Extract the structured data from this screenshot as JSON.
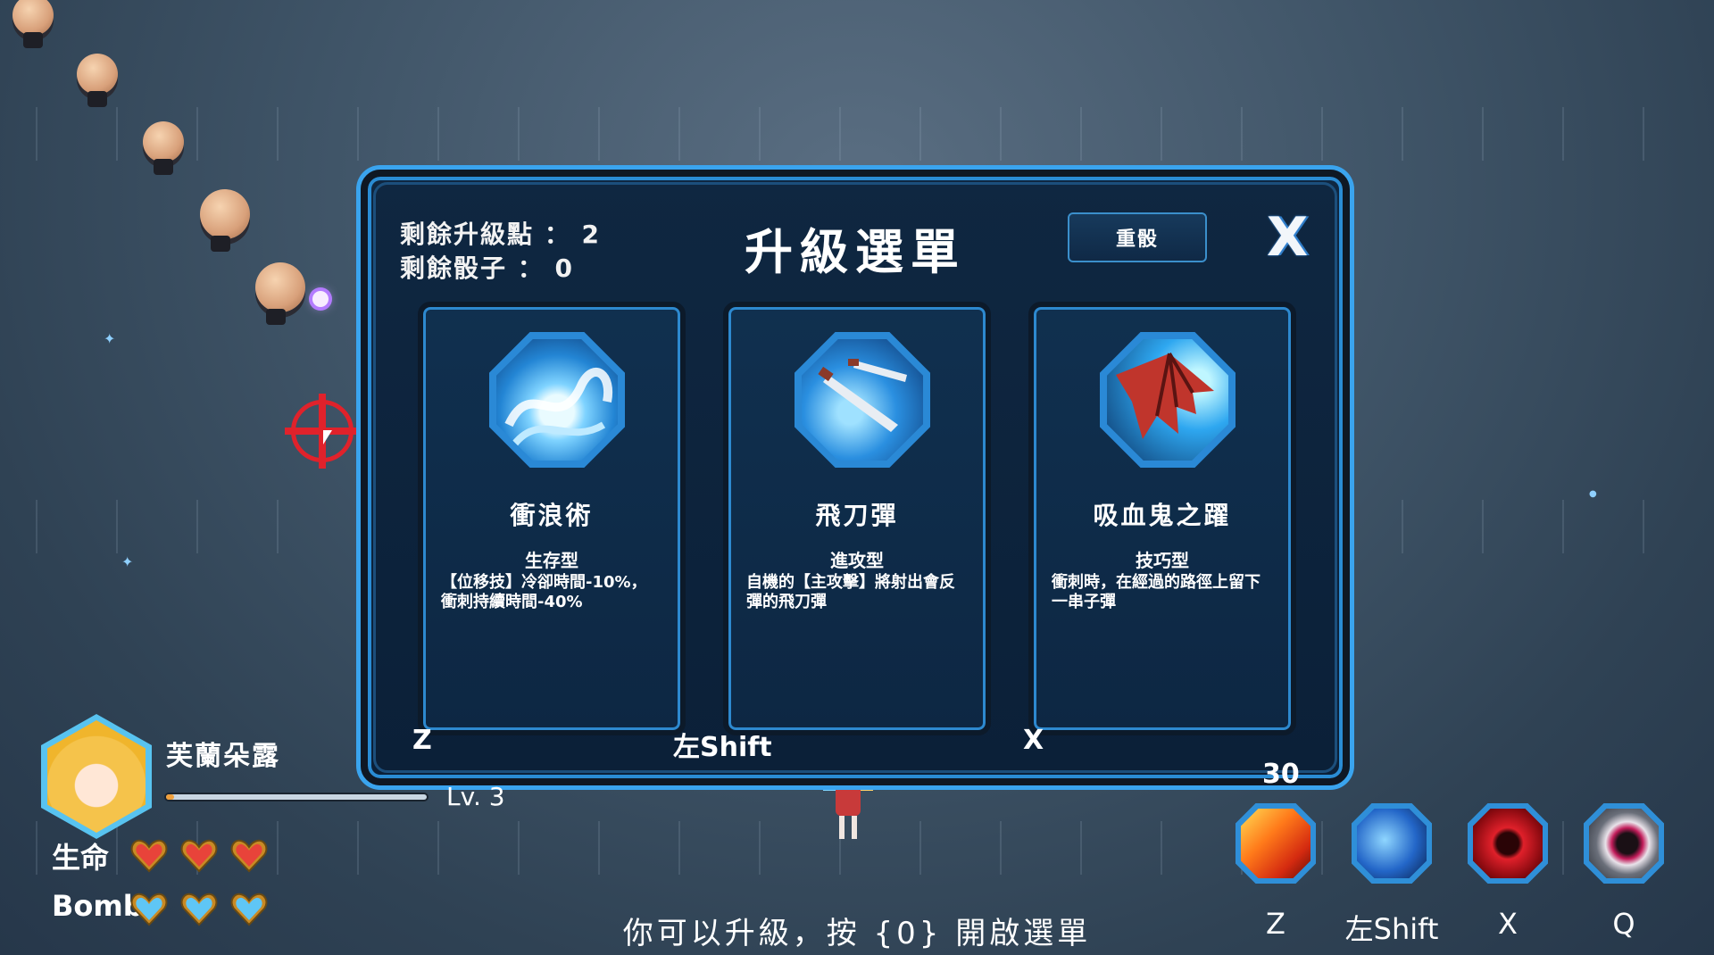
{
  "upgrade_menu": {
    "title": "升級選單",
    "points_text": "剩餘升級點 ： 2",
    "dice_text": "剩餘骰子 ： 0",
    "reset_label": "重骰",
    "close_label": "X",
    "cards": [
      {
        "name": "衝浪術",
        "type": "生存型",
        "description": "【位移技】冷卻時間-10%，衝刺持續時間-40%",
        "icon": "wave-icon",
        "hotkey": "Z"
      },
      {
        "name": "飛刀彈",
        "type": "進攻型",
        "description": "自機的【主攻擊】將射出會反彈的飛刀彈",
        "icon": "knives-icon",
        "hotkey": "左Shift"
      },
      {
        "name": "吸血鬼之躍",
        "type": "技巧型",
        "description": "衝刺時，在經過的路徑上留下一串子彈",
        "icon": "bat-wing-icon",
        "hotkey": "X"
      }
    ],
    "countdown": "30"
  },
  "player": {
    "name": "芙蘭朵露",
    "level_text": "Lv. 3",
    "xp_fraction": 0.03,
    "life_label": "生命",
    "life_count": 3,
    "bomb_label": "Bomb",
    "bomb_count": 3
  },
  "skills": [
    {
      "key": "Z",
      "icon": "flame-slash-icon"
    },
    {
      "key": "左Shift",
      "icon": "dash-icon"
    },
    {
      "key": "X",
      "icon": "blood-orb-icon"
    },
    {
      "key": "Q",
      "icon": "ring-icon"
    }
  ],
  "hint_text": "你可以升級，按 {0} 開啟選單",
  "colors": {
    "panel_border": "#2a8cd4",
    "life": "#e8433a",
    "bomb": "#5fc6f5",
    "crosshair": "#e0222b"
  }
}
